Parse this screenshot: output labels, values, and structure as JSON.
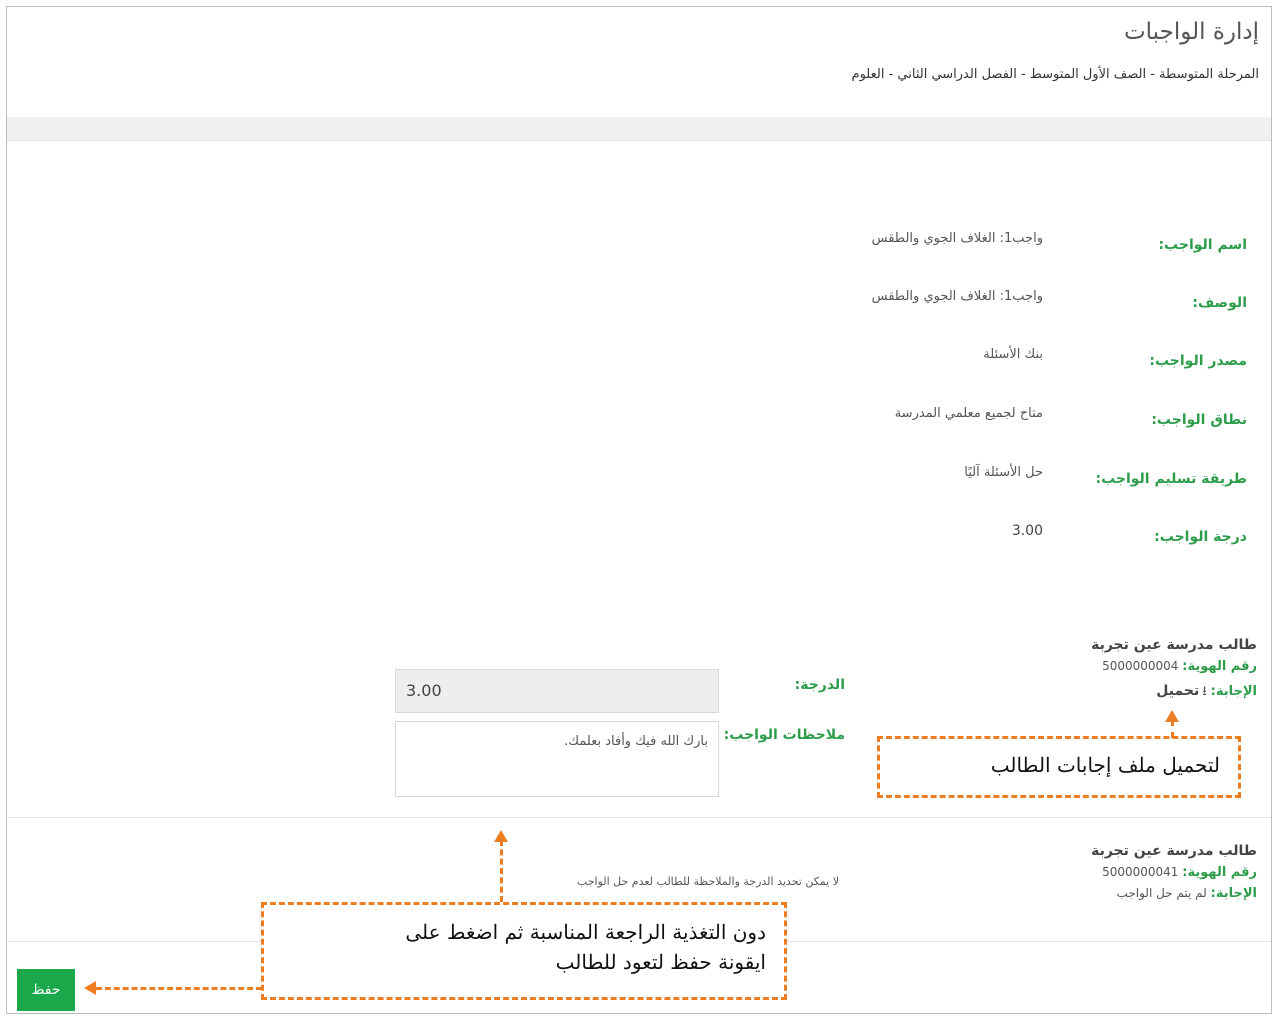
{
  "header": {
    "title": "إدارة الواجبات",
    "breadcrumb": "المرحلة المتوسطة - الصف الأول المتوسط - الفصل الدراسي الثاني - العلوم"
  },
  "assignment": {
    "fields": [
      {
        "label": "اسم الواجب:",
        "value": "واجب1: الغلاف الجوي والطقس"
      },
      {
        "label": "الوصف:",
        "value": "واجب1: الغلاف الجوي والطقس"
      },
      {
        "label": "مصدر الواجب:",
        "value": "بنك الأسئلة"
      },
      {
        "label": "نطاق الواجب:",
        "value": "متاح لجميع معلمي المدرسة"
      },
      {
        "label": "طريقة تسليم الواجب:",
        "value": "حل الأسئلة آليًا"
      },
      {
        "label": "درجة الواجب:",
        "value": "3.00"
      }
    ]
  },
  "students": [
    {
      "name": "طالب مدرسة عين تجربة",
      "id_label": "رقم الهوية:",
      "id_value": "5000000004",
      "answer_label": "الإجابة:",
      "answer_link": "تحميل",
      "answer_icon": "download-icon",
      "grade_label": "الدرجة:",
      "grade_value": "3.00",
      "notes_label": "ملاحظات الواجب:",
      "notes_value": "بارك الله فيك وأفاد بعلمك."
    },
    {
      "name": "طالب مدرسة عين تجربة",
      "id_label": "رقم الهوية:",
      "id_value": "5000000041",
      "answer_label": "الإجابة:",
      "answer_text": "لم يتم حل الواجب",
      "message": "لا يمكن تحديد الدرجة والملاحظة للطالب لعدم حل الواجب"
    }
  ],
  "actions": {
    "save_label": "حفظ"
  },
  "callouts": {
    "download": "لتحميل ملف إجابات الطالب",
    "feedback_line1": "دون التغذية الراجعة المناسبة ثم اضغط على",
    "feedback_line2": "ايقونة حفظ لتعود للطالب"
  },
  "colors": {
    "label_green": "#2e9d4b",
    "save_green": "#1aa84a",
    "callout_orange": "#ee7d22"
  }
}
